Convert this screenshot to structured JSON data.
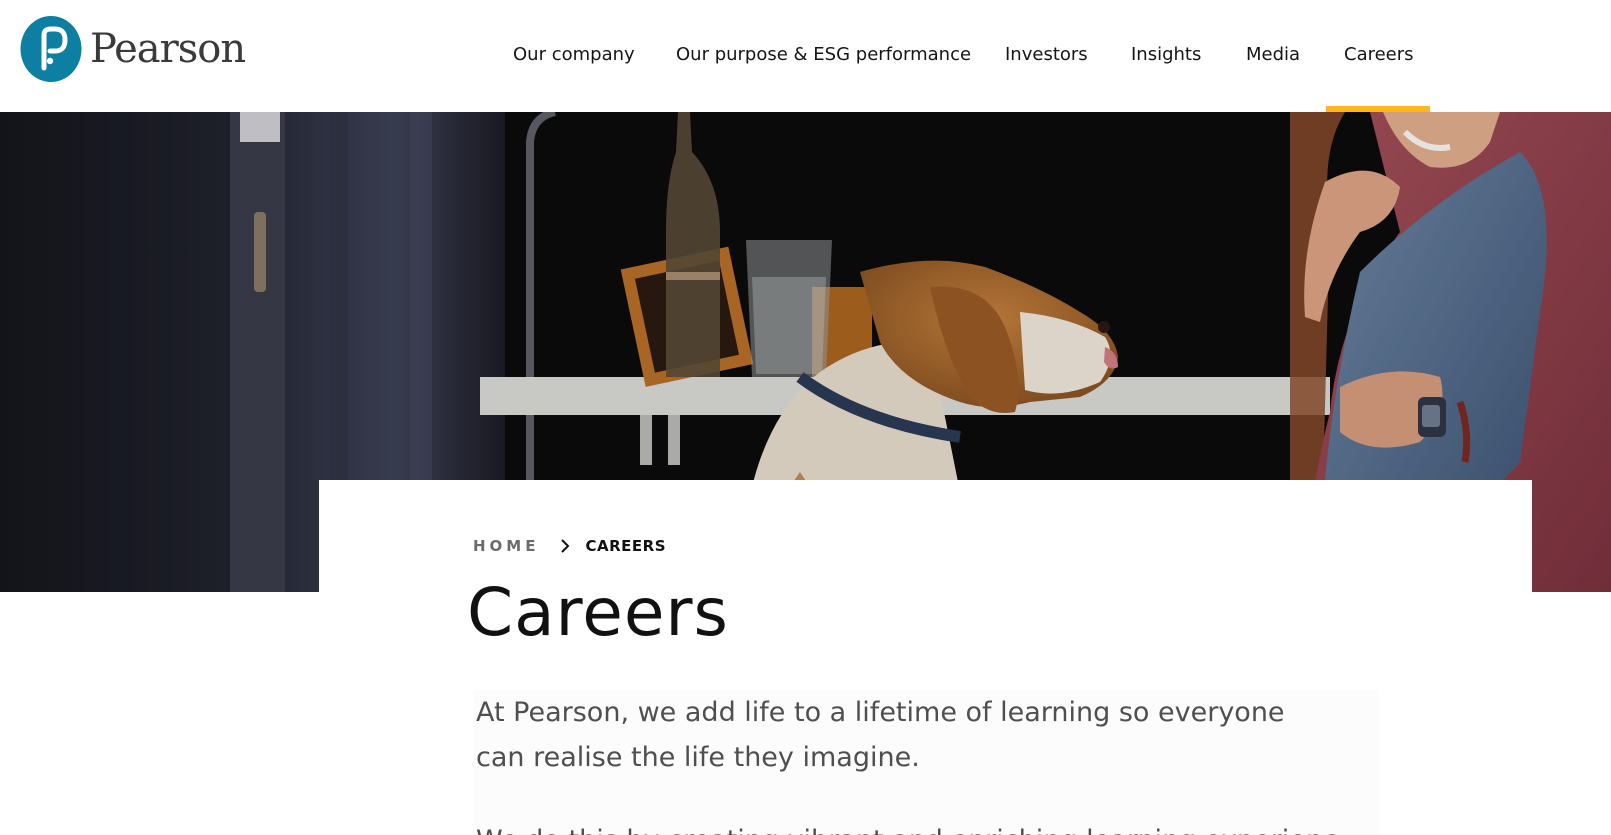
{
  "brand": {
    "name": "Pearson",
    "logo_color": "#0d7fa3"
  },
  "nav": {
    "items": [
      {
        "label": "Our company"
      },
      {
        "label": "Our purpose & ESG performance"
      },
      {
        "label": "Investors"
      },
      {
        "label": "Insights"
      },
      {
        "label": "Media"
      },
      {
        "label": "Careers",
        "active": true
      }
    ],
    "active_color": "#ffb81c"
  },
  "breadcrumb": {
    "home": "HOME",
    "current": "CAREERS"
  },
  "page": {
    "title": "Careers",
    "intro": "At Pearson, we add life to a lifetime of learning so everyone can realise the life they imagine.",
    "intro_continued": "We do this by creating vibrant and enriching learning experiences"
  },
  "hero": {
    "image_alt": "Woman at desk smiling at a beagle dog"
  }
}
